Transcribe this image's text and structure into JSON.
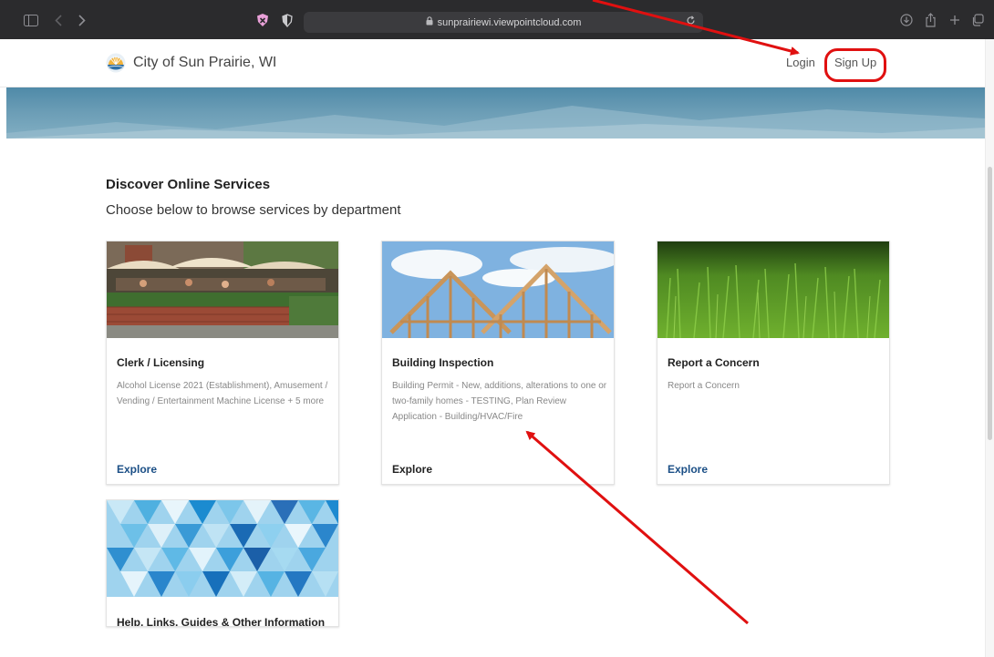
{
  "browser": {
    "url": "sunprairiewi.viewpointcloud.com"
  },
  "header": {
    "site_title": "City of Sun Prairie, WI",
    "login_label": "Login",
    "signup_label": "Sign Up"
  },
  "main": {
    "section_title": "Discover Online Services",
    "section_subtitle": "Choose below to browse services by department",
    "cards": [
      {
        "title": "Clerk / Licensing",
        "description": "Alcohol License 2021 (Establishment), Amusement / Vending / Entertainment Machine License + 5 more",
        "explore": "Explore"
      },
      {
        "title": "Building Inspection",
        "description": "Building Permit - New, additions, alterations to one or two-family homes - TESTING, Plan Review Application - Building/HVAC/Fire",
        "explore": "Explore"
      },
      {
        "title": "Report a Concern",
        "description": "Report a Concern",
        "explore": "Explore"
      },
      {
        "title": "Help, Links, Guides & Other Information"
      }
    ]
  },
  "colors": {
    "toolbar": "#2b2b2d",
    "explore_link": "#1b4f86",
    "annotation_red": "#e01010"
  }
}
